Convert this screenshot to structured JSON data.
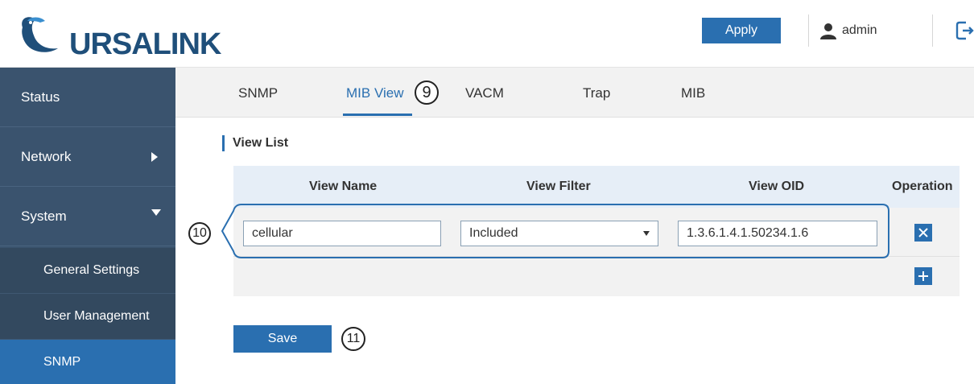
{
  "header": {
    "logo_text": "URSALINK",
    "apply_label": "Apply",
    "username": "admin"
  },
  "sidebar": {
    "items": [
      {
        "label": "Status"
      },
      {
        "label": "Network"
      },
      {
        "label": "System"
      }
    ],
    "sub_items": [
      {
        "label": "General Settings"
      },
      {
        "label": "User Management"
      },
      {
        "label": "SNMP"
      }
    ]
  },
  "tabs": [
    {
      "label": "SNMP"
    },
    {
      "label": "MIB View"
    },
    {
      "label": "VACM"
    },
    {
      "label": "Trap"
    },
    {
      "label": "MIB"
    }
  ],
  "callouts": {
    "n9": "9",
    "n10": "10",
    "n11": "11"
  },
  "view_list": {
    "title": "View List",
    "columns": {
      "name": "View Name",
      "filter": "View Filter",
      "oid": "View OID",
      "operation": "Operation"
    },
    "rows": [
      {
        "view_name": "cellular",
        "view_filter": "Included",
        "view_oid": "1.3.6.1.4.1.50234.1.6"
      }
    ]
  },
  "save_label": "Save",
  "colors": {
    "accent": "#2a6fb0",
    "sidebar": "#3a536e",
    "logo": "#1f4f7a"
  }
}
